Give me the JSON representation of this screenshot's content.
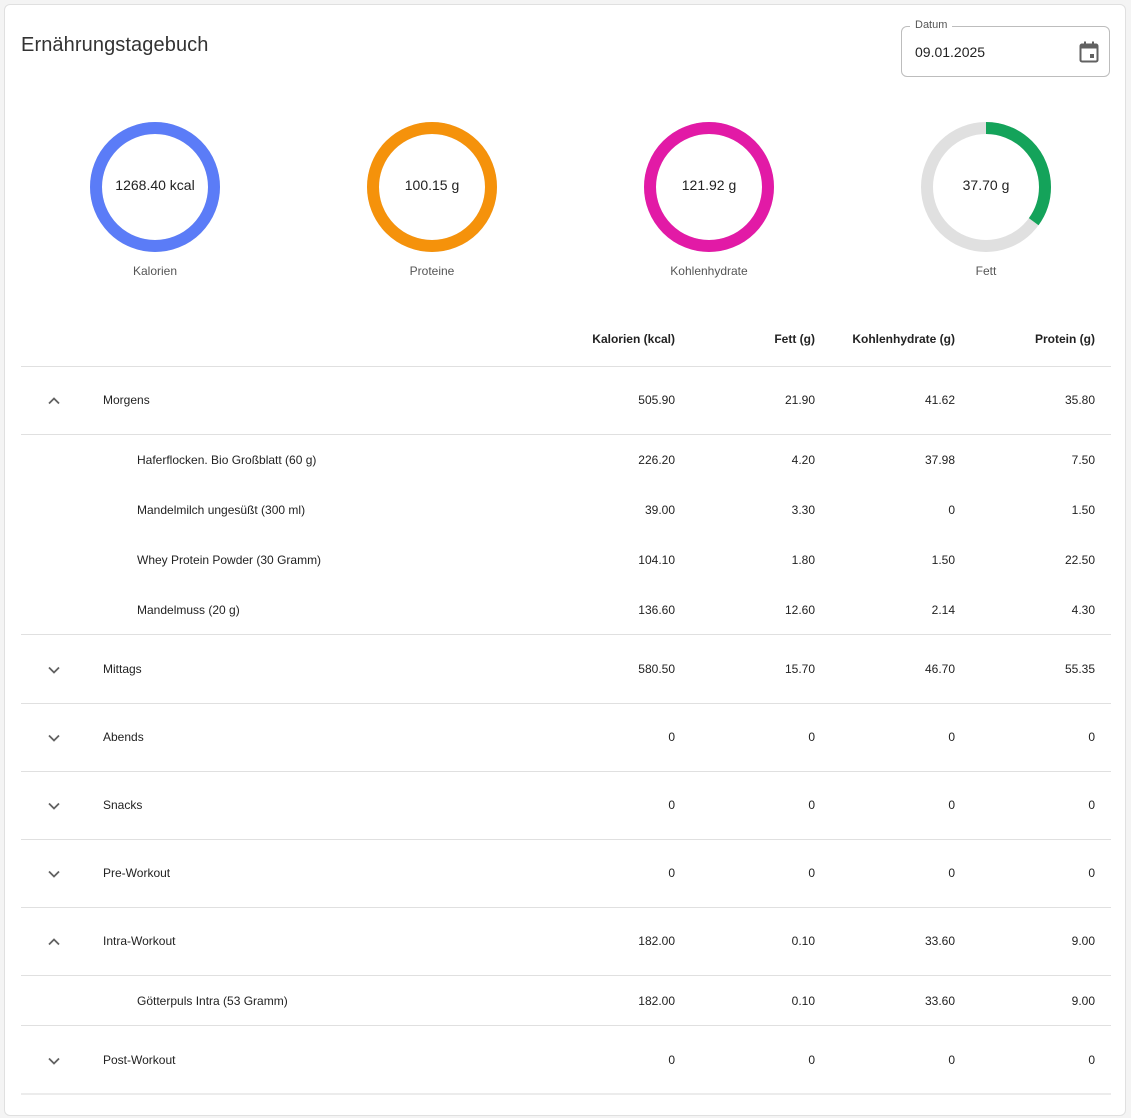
{
  "header": {
    "title": "Ernährungstagebuch",
    "date_label": "Datum",
    "date_value": "09.01.2025",
    "calendar_icon": "calendar-icon"
  },
  "rings": [
    {
      "label": "Kalorien",
      "value": "1268.40 kcal",
      "color": "#5b7cf7",
      "fill": 1.0
    },
    {
      "label": "Proteine",
      "value": "100.15 g",
      "color": "#f5920b",
      "fill": 1.0
    },
    {
      "label": "Kohlenhydrate",
      "value": "121.92 g",
      "color": "#e21aa6",
      "fill": 1.0
    },
    {
      "label": "Fett",
      "value": "37.70 g",
      "color": "#14a35a",
      "fill": 0.35
    }
  ],
  "ring_track_color": "#e0e0e0",
  "table": {
    "headers": [
      "Kalorien (kcal)",
      "Fett (g)",
      "Kohlenhydrate (g)",
      "Protein (g)"
    ],
    "groups": [
      {
        "name": "Morgens",
        "expanded": true,
        "values": [
          "505.90",
          "21.90",
          "41.62",
          "35.80"
        ],
        "items": [
          {
            "name": "Haferflocken. Bio Großblatt (60 g)",
            "values": [
              "226.20",
              "4.20",
              "37.98",
              "7.50"
            ]
          },
          {
            "name": "Mandelmilch ungesüßt (300 ml)",
            "values": [
              "39.00",
              "3.30",
              "0",
              "1.50"
            ]
          },
          {
            "name": "Whey Protein Powder (30 Gramm)",
            "values": [
              "104.10",
              "1.80",
              "1.50",
              "22.50"
            ]
          },
          {
            "name": "Mandelmuss (20 g)",
            "values": [
              "136.60",
              "12.60",
              "2.14",
              "4.30"
            ]
          }
        ]
      },
      {
        "name": "Mittags",
        "expanded": false,
        "values": [
          "580.50",
          "15.70",
          "46.70",
          "55.35"
        ],
        "items": []
      },
      {
        "name": "Abends",
        "expanded": false,
        "values": [
          "0",
          "0",
          "0",
          "0"
        ],
        "items": []
      },
      {
        "name": "Snacks",
        "expanded": false,
        "values": [
          "0",
          "0",
          "0",
          "0"
        ],
        "items": []
      },
      {
        "name": "Pre-Workout",
        "expanded": false,
        "values": [
          "0",
          "0",
          "0",
          "0"
        ],
        "items": []
      },
      {
        "name": "Intra-Workout",
        "expanded": true,
        "values": [
          "182.00",
          "0.10",
          "33.60",
          "9.00"
        ],
        "items": [
          {
            "name": "Götterpuls Intra (53 Gramm)",
            "values": [
              "182.00",
              "0.10",
              "33.60",
              "9.00"
            ]
          }
        ]
      },
      {
        "name": "Post-Workout",
        "expanded": false,
        "values": [
          "0",
          "0",
          "0",
          "0"
        ],
        "items": []
      }
    ]
  }
}
